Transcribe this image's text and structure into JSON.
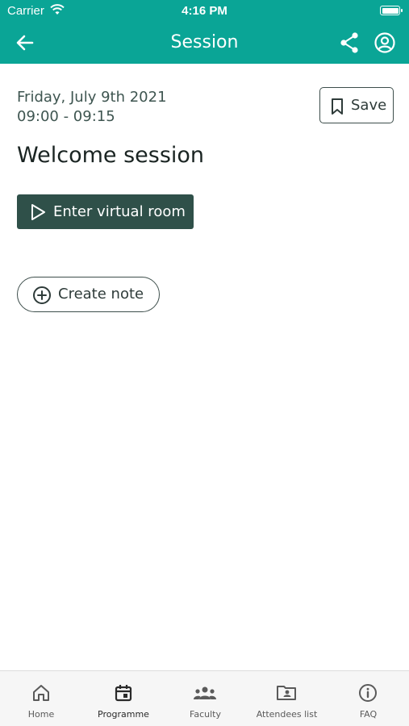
{
  "status_bar": {
    "carrier": "Carrier",
    "time": "4:16 PM"
  },
  "header": {
    "title": "Session",
    "back_icon": "arrow-left-icon",
    "share_icon": "share-icon",
    "account_icon": "account-circle-icon"
  },
  "session": {
    "date": "Friday, July 9th 2021",
    "time_range": "09:00 - 09:15",
    "title": "Welcome session",
    "save_label": "Save",
    "enter_room_label": "Enter virtual room",
    "create_note_label": "Create note"
  },
  "tabbar": {
    "active": "Programme",
    "items": [
      {
        "label": "Home",
        "icon": "home-icon"
      },
      {
        "label": "Programme",
        "icon": "calendar-icon"
      },
      {
        "label": "Faculty",
        "icon": "group-icon"
      },
      {
        "label": "Attendees list",
        "icon": "contacts-folder-icon"
      },
      {
        "label": "FAQ",
        "icon": "info-icon"
      }
    ]
  },
  "colors": {
    "header": "#0aa596",
    "primary_button": "#2f5049",
    "tabbar": "#f6f6f6"
  }
}
